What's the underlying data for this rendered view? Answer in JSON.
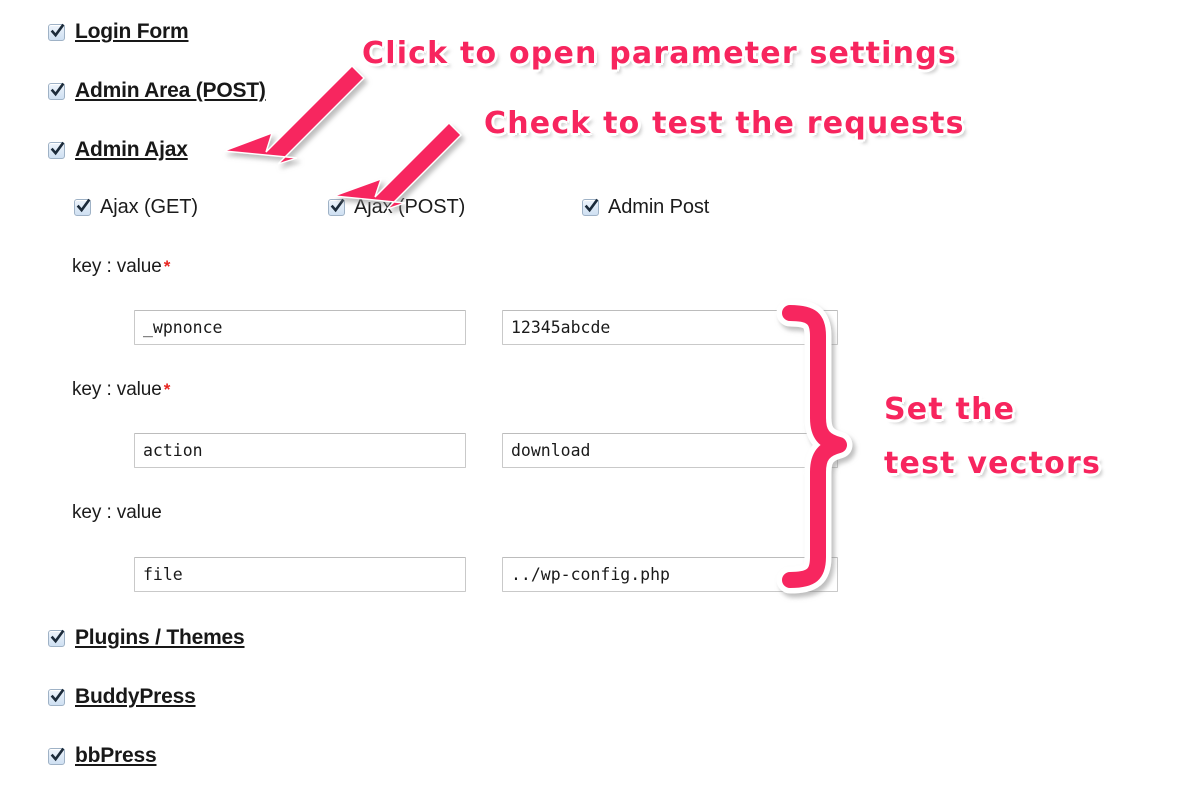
{
  "colors": {
    "accent_pink": "#f7255e",
    "required_red": "#e8241f",
    "text": "#181818",
    "field_border": "#c9c9c9"
  },
  "sections_top": [
    {
      "label": "Login Form",
      "checked": true,
      "name": "login-form"
    },
    {
      "label": "Admin Area (POST)",
      "checked": true,
      "name": "admin-area-post"
    },
    {
      "label": "Admin Ajax",
      "checked": true,
      "name": "admin-ajax"
    }
  ],
  "sub_options": [
    {
      "label": "Ajax (GET)",
      "checked": true,
      "name": "ajax-get"
    },
    {
      "label": "Ajax (POST)",
      "checked": true,
      "name": "ajax-post"
    },
    {
      "label": "Admin Post",
      "checked": true,
      "name": "admin-post"
    }
  ],
  "param_rows": [
    {
      "label": "key : value",
      "required": true,
      "key": "_wpnonce",
      "value": "12345abcde"
    },
    {
      "label": "key : value",
      "required": true,
      "key": "action",
      "value": "download"
    },
    {
      "label": "key : value",
      "required": false,
      "key": "file",
      "value": "../wp-config.php"
    }
  ],
  "required_marker": "*",
  "sections_bottom": [
    {
      "label": "Plugins / Themes",
      "checked": true,
      "name": "plugins-themes"
    },
    {
      "label": "BuddyPress",
      "checked": true,
      "name": "buddypress"
    },
    {
      "label": "bbPress",
      "checked": true,
      "name": "bbpress"
    }
  ],
  "annotations": [
    {
      "text": "Click to open parameter settings",
      "name": "annotation-click-to-open"
    },
    {
      "text": "Check to test the requests",
      "name": "annotation-check-to-test"
    },
    {
      "text": "Set the",
      "name": "annotation-set-the"
    },
    {
      "text": "test vectors",
      "name": "annotation-test-vectors"
    }
  ]
}
